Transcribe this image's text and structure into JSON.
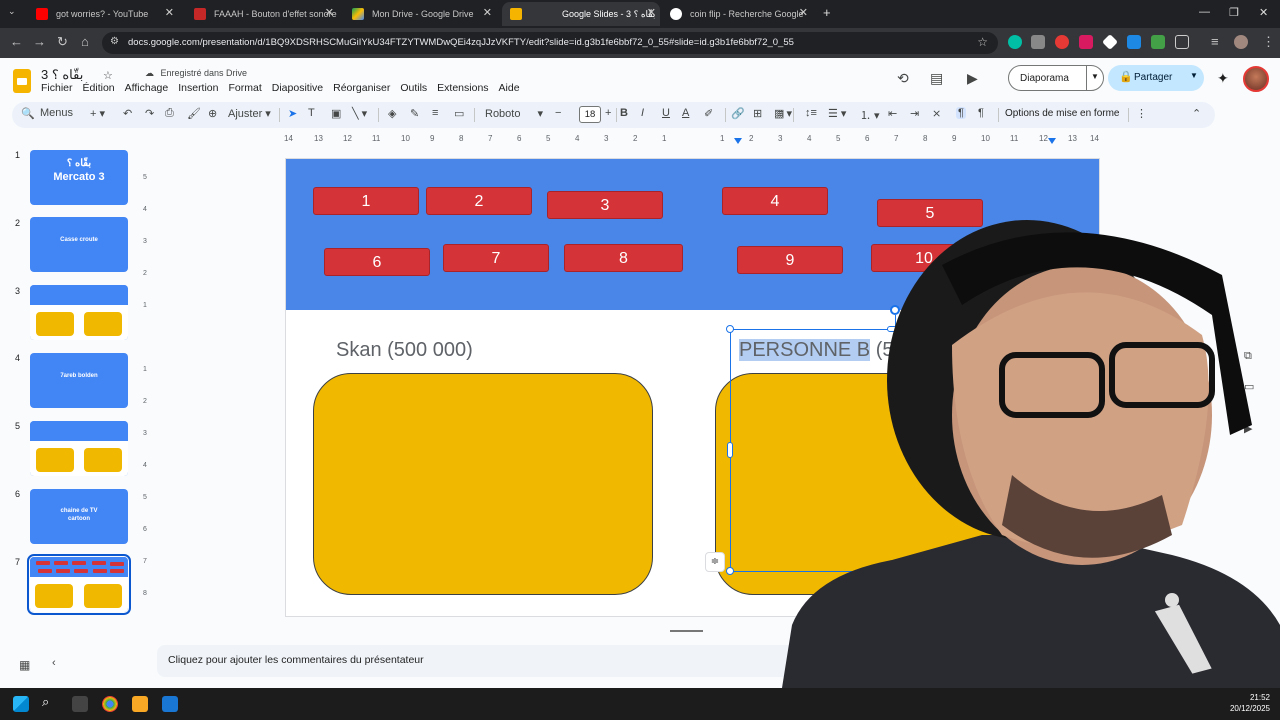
{
  "browser": {
    "tabs": [
      {
        "title": "got worries? - YouTube",
        "favicon_color": "#ff0000"
      },
      {
        "title": "FAAAH - Bouton d'effet sonore",
        "favicon_color": "#c62828"
      },
      {
        "title": "Mon Drive - Google Drive",
        "favicon_color": "#34a853"
      },
      {
        "title": "Google Slides - بقّاه ؟ 3",
        "favicon_color": "#f4b400",
        "active": true
      },
      {
        "title": "coin flip - Recherche Google",
        "favicon_color": "#ffffff"
      }
    ],
    "url": "docs.google.com/presentation/d/1BQ9XDSRHSCMuGiIYkU34FTZYTWMDwQEi4zqJJzVKFTY/edit?slide=id.g3b1fe6bbf72_0_55#slide=id.g3b1fe6bbf72_0_55"
  },
  "doc": {
    "title": "بقّاه ؟ 3",
    "saved_status": "Enregistré dans Drive",
    "menu": [
      "Fichier",
      "Édition",
      "Affichage",
      "Insertion",
      "Format",
      "Diapositive",
      "Réorganiser",
      "Outils",
      "Extensions",
      "Aide"
    ],
    "slideshow_label": "Diaporama",
    "share_label": "Partager"
  },
  "toolbar": {
    "menus_label": "Menus",
    "zoom_label": "Ajuster",
    "font": "Roboto",
    "font_size": "18",
    "format_options": "Options de mise en forme"
  },
  "ruler": {
    "top": [
      "14",
      "13",
      "12",
      "11",
      "10",
      "9",
      "8",
      "7",
      "6",
      "5",
      "4",
      "3",
      "2",
      "1",
      "1",
      "2",
      "3",
      "4",
      "5",
      "6",
      "7",
      "8",
      "9",
      "10",
      "11",
      "12",
      "13",
      "14"
    ],
    "left": [
      "5",
      "4",
      "3",
      "2",
      "1",
      "1",
      "2",
      "3",
      "4",
      "5",
      "6",
      "7",
      "8"
    ]
  },
  "slides": [
    {
      "number": "1",
      "lines": [
        "بقّاه ؟",
        "Mercato 3"
      ]
    },
    {
      "number": "2",
      "lines": [
        "Casse croute"
      ]
    },
    {
      "number": "3",
      "lines": []
    },
    {
      "number": "4",
      "lines": [
        "7areb bolden"
      ]
    },
    {
      "number": "5",
      "lines": []
    },
    {
      "number": "6",
      "lines": [
        "chaine de TV",
        "cartoon"
      ]
    },
    {
      "number": "7",
      "lines": [],
      "selected": true
    }
  ],
  "canvas": {
    "numbers": [
      "1",
      "2",
      "3",
      "4",
      "5",
      "6",
      "7",
      "8",
      "9",
      "10"
    ],
    "left_player": "Skan (500 000)",
    "right_player_selected": "PERSONNE B",
    "right_player_rest": " (500 000)"
  },
  "notes": {
    "placeholder": "Cliquez pour ajouter les commentaires du présentateur"
  },
  "taskbar": {
    "time": "21:52",
    "date": "20/12/2025"
  },
  "colors": {
    "banner": "#4a86e8",
    "number_button": "#d43338",
    "player_box": "#f1b800",
    "selection": "#1a73e8"
  }
}
